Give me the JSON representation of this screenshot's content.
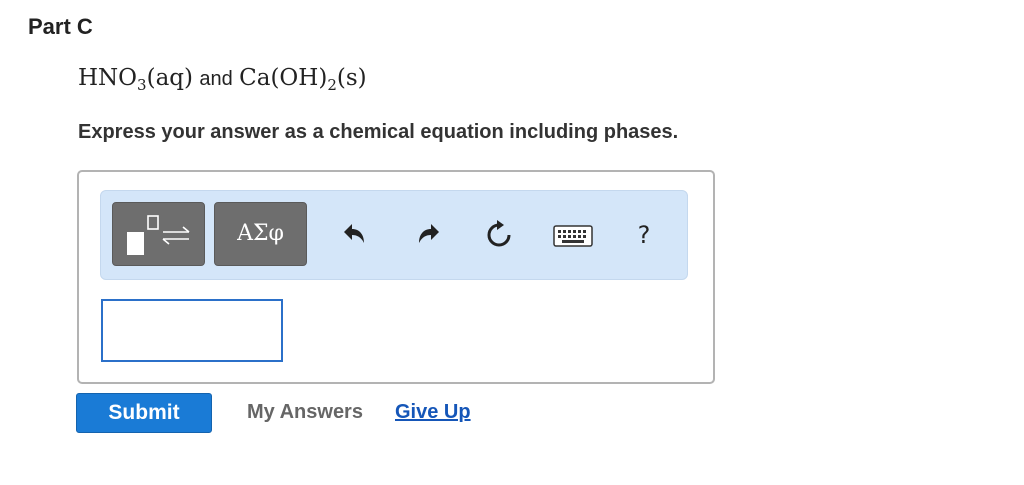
{
  "part": {
    "title": "Part C"
  },
  "question": {
    "reactant1_formula": "HNO",
    "reactant1_sub": "3",
    "reactant1_phase": "(aq)",
    "conjunction": "and",
    "reactant2_formula": "Ca(OH)",
    "reactant2_sub": "2",
    "reactant2_phase": "(s)"
  },
  "instruction": "Express your answer as a chemical equation including phases.",
  "toolbar": {
    "templates_icon": "templates-icon",
    "greek_label": "ΑΣφ",
    "undo_icon": "undo-icon",
    "redo_icon": "redo-icon",
    "reset_icon": "reset-icon",
    "keyboard_icon": "keyboard-icon",
    "help_label": "?"
  },
  "answer": {
    "value": ""
  },
  "actions": {
    "submit_label": "Submit",
    "my_answers_label": "My Answers",
    "give_up_label": "Give Up"
  },
  "colors": {
    "submit_bg": "#1a7bd6",
    "toolbar_bg": "#d4e6f9",
    "link": "#1556b8",
    "input_border": "#2b70c9"
  }
}
